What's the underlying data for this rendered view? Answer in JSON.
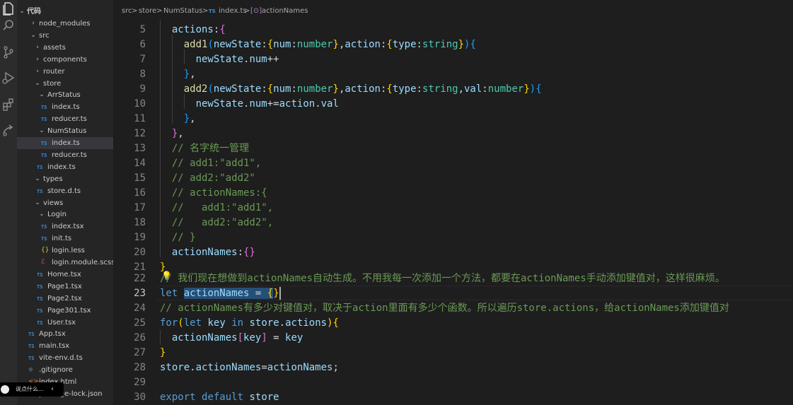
{
  "explorer": {
    "root_label": "代码",
    "items": [
      {
        "label": "node_modules",
        "kind": "folder",
        "open": false
      },
      {
        "label": "src",
        "kind": "folder",
        "open": true
      },
      {
        "label": "assets",
        "kind": "folder",
        "open": false
      },
      {
        "label": "components",
        "kind": "folder",
        "open": false
      },
      {
        "label": "router",
        "kind": "folder",
        "open": false
      },
      {
        "label": "store",
        "kind": "folder",
        "open": true
      },
      {
        "label": "ArrStatus",
        "kind": "folder",
        "open": true
      },
      {
        "label": "index.ts",
        "kind": "ts"
      },
      {
        "label": "reducer.ts",
        "kind": "ts"
      },
      {
        "label": "NumStatus",
        "kind": "folder",
        "open": true
      },
      {
        "label": "index.ts",
        "kind": "ts",
        "selected": true
      },
      {
        "label": "reducer.ts",
        "kind": "ts"
      },
      {
        "label": "index.ts",
        "kind": "ts"
      },
      {
        "label": "types",
        "kind": "folder",
        "open": true
      },
      {
        "label": "store.d.ts",
        "kind": "ts"
      },
      {
        "label": "views",
        "kind": "folder",
        "open": true
      },
      {
        "label": "Login",
        "kind": "folder",
        "open": true
      },
      {
        "label": "index.tsx",
        "kind": "ts"
      },
      {
        "label": "init.ts",
        "kind": "ts"
      },
      {
        "label": "login.less",
        "kind": "braces"
      },
      {
        "label": "login.module.scss",
        "kind": "scss"
      },
      {
        "label": "Home.tsx",
        "kind": "ts"
      },
      {
        "label": "Page1.tsx",
        "kind": "ts"
      },
      {
        "label": "Page2.tsx",
        "kind": "ts"
      },
      {
        "label": "Page301.tsx",
        "kind": "ts"
      },
      {
        "label": "User.tsx",
        "kind": "ts"
      },
      {
        "label": "App.tsx",
        "kind": "ts"
      },
      {
        "label": "main.tsx",
        "kind": "ts"
      },
      {
        "label": "vite-env.d.ts",
        "kind": "ts"
      },
      {
        "label": ".gitignore",
        "kind": "git"
      },
      {
        "label": "index.html",
        "kind": "html"
      },
      {
        "label": "package-lock.json",
        "kind": "json"
      }
    ],
    "ts_badge": "TS",
    "braces_badge": "{}"
  },
  "breadcrumb": {
    "parts": [
      "src",
      "store",
      "NumStatus",
      "index.ts",
      "actionNames"
    ],
    "separator": ">",
    "ts_badge": "TS",
    "symbol_badge": "[⊙]"
  },
  "editor": {
    "line_numbers": [
      "5",
      "6",
      "7",
      "8",
      "9",
      "10",
      "11",
      "12",
      "13",
      "14",
      "15",
      "16",
      "17",
      "18",
      "19",
      "20",
      "21",
      "22",
      "23",
      "24",
      "25",
      "26",
      "27",
      "28",
      "29",
      "30"
    ],
    "active_line": "23"
  },
  "overlay": {
    "text": "说点什么...",
    "arrow": "‹"
  },
  "colors": {
    "keyword": "#569cd6",
    "variable": "#9cdcfe",
    "function": "#dcdcaa",
    "type": "#4ec9b0",
    "comment": "#6a9955",
    "selection": "#264f78",
    "ts_icon": "#3e8fd9"
  },
  "icons": [
    "explorer-icon",
    "search-icon",
    "source-control-icon",
    "run-debug-icon",
    "extensions-icon",
    "remote-icon",
    "lightbulb-icon"
  ]
}
